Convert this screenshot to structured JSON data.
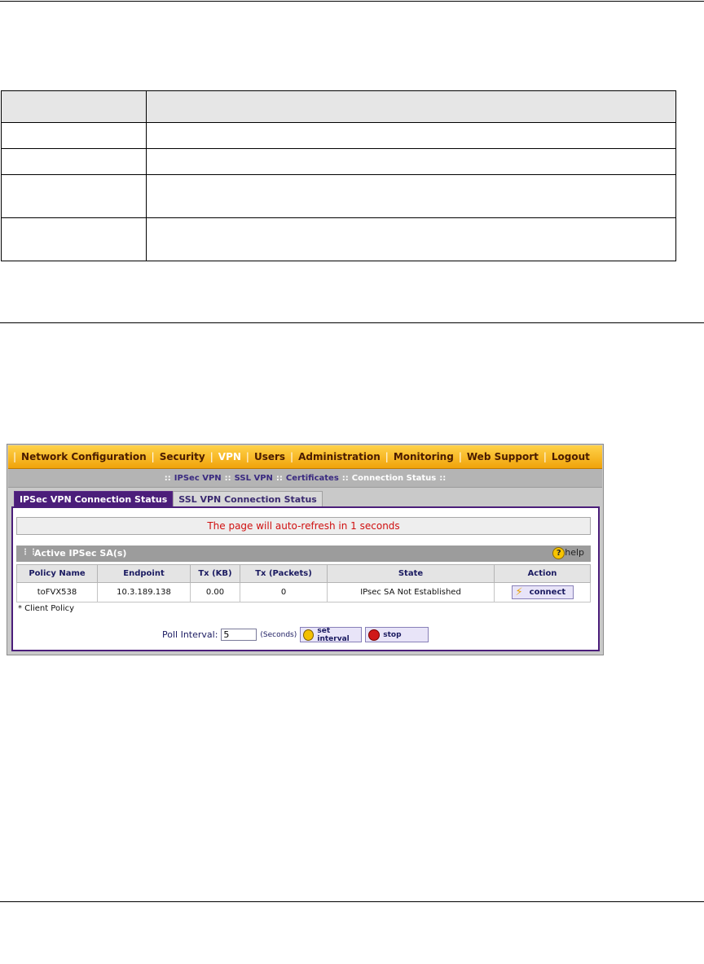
{
  "nav": {
    "items": [
      "Network Configuration",
      "Security",
      "VPN",
      "Users",
      "Administration",
      "Monitoring",
      "Web Support",
      "Logout"
    ],
    "active": "VPN"
  },
  "subnav": {
    "items": [
      "IPSec VPN",
      "SSL VPN",
      "Certificates",
      "Connection Status"
    ],
    "active": "Connection Status"
  },
  "tabs": [
    "IPSec VPN Connection Status",
    "SSL VPN Connection Status"
  ],
  "refresh_text": "The page will auto-refresh in 1 seconds",
  "sa_section": {
    "title": "Active IPSec SA(s)",
    "help_label": "help",
    "columns": [
      "Policy Name",
      "Endpoint",
      "Tx (KB)",
      "Tx (Packets)",
      "State",
      "Action"
    ],
    "rows": [
      {
        "policy": "toFVX538",
        "endpoint": "10.3.189.138",
        "tx_kb": "0.00",
        "tx_packets": "0",
        "state": "IPsec SA Not Established",
        "action": "connect"
      }
    ]
  },
  "client_policy_note": "* Client Policy",
  "poll": {
    "label": "Poll Interval:",
    "value": "5",
    "unit": "(Seconds)",
    "set_interval_label": "set interval",
    "stop_label": "stop"
  }
}
